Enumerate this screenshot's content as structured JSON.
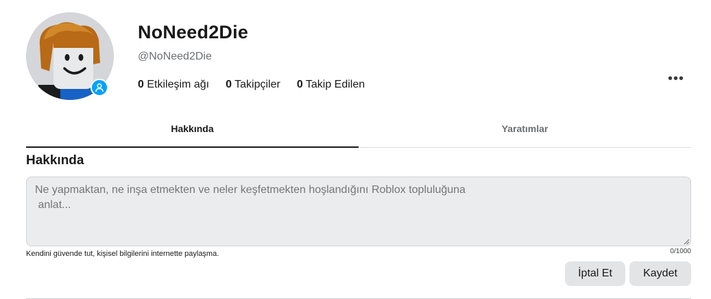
{
  "profile": {
    "display_name": "NoNeed2Die",
    "username": "@NoNeed2Die",
    "stats": [
      {
        "count": "0",
        "label": "Etkileşim ağı"
      },
      {
        "count": "0",
        "label": "Takipçiler"
      },
      {
        "count": "0",
        "label": "Takip Edilen"
      }
    ],
    "more_label": "•••"
  },
  "tabs": [
    {
      "label": "Hakkında",
      "active": true
    },
    {
      "label": "Yaratımlar",
      "active": false
    }
  ],
  "about": {
    "title": "Hakkında",
    "placeholder": "Ne yapmaktan, ne inşa etmekten ve neler keşfetmekten hoşlandığını Roblox topluluğuna\n anlat...",
    "value": "",
    "hint": "Kendini güvende tut, kişisel bilgilerini internette paylaşma.",
    "counter": "0/1000",
    "cancel_label": "İptal Et",
    "save_label": "Kaydet"
  },
  "colors": {
    "accent": "#00a2ff",
    "button_bg": "#e3e4e6",
    "textarea_bg": "#ebecee"
  }
}
